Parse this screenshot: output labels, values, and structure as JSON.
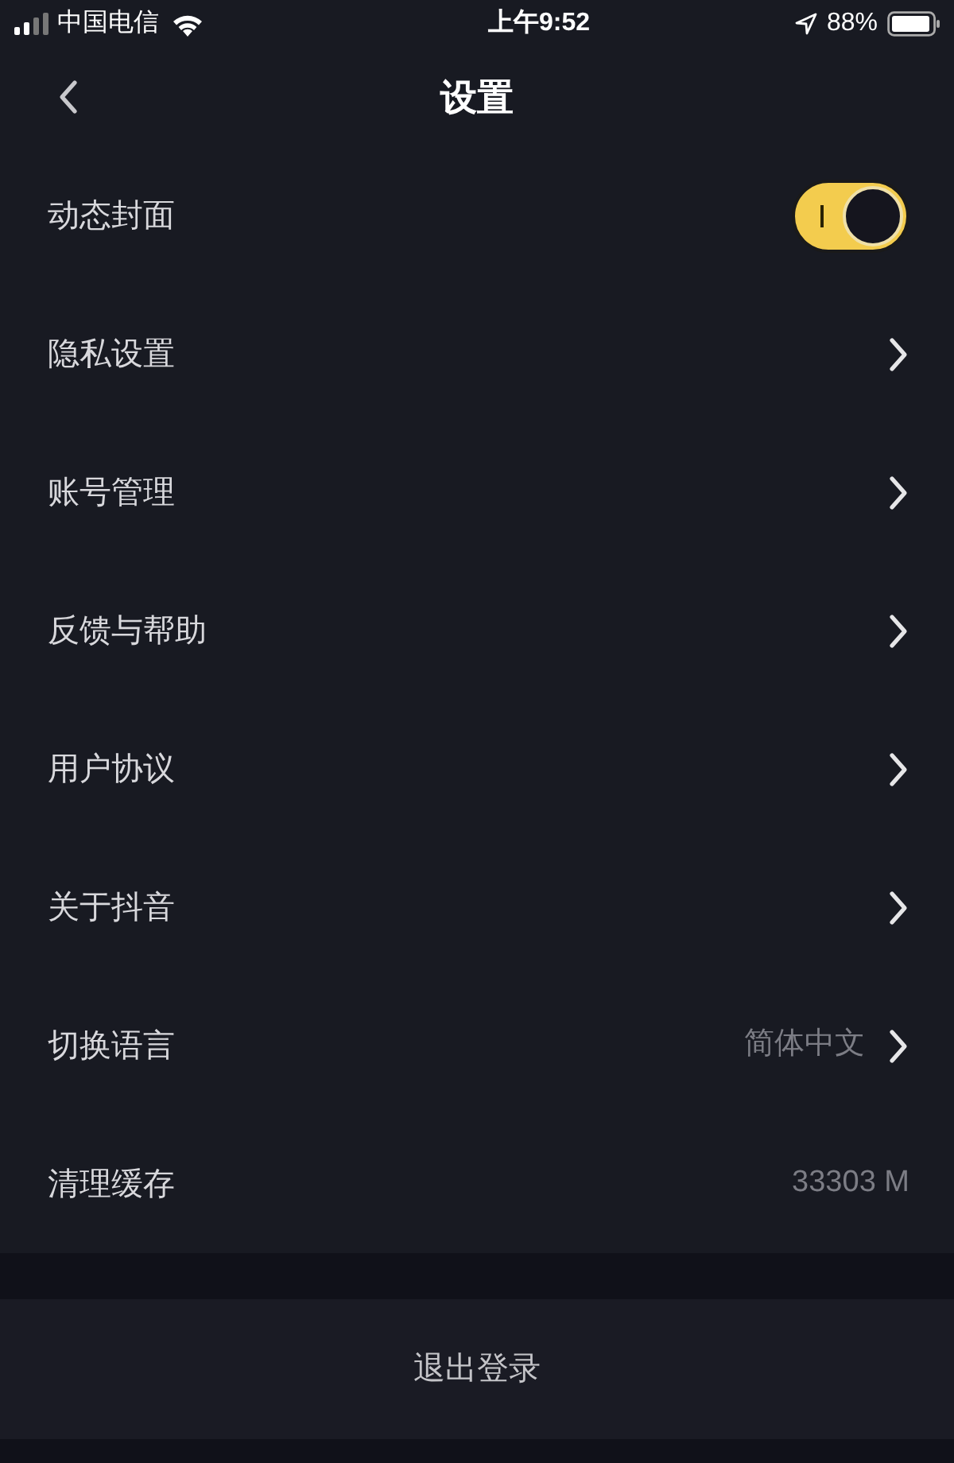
{
  "status_bar": {
    "carrier": "中国电信",
    "time": "上午9:52",
    "battery": "88%"
  },
  "nav": {
    "title": "设置"
  },
  "items": [
    {
      "kind": "toggle",
      "label": "动态封面",
      "on": true
    },
    {
      "kind": "link",
      "label": "隐私设置"
    },
    {
      "kind": "link",
      "label": "账号管理"
    },
    {
      "kind": "link",
      "label": "反馈与帮助"
    },
    {
      "kind": "link",
      "label": "用户协议"
    },
    {
      "kind": "link",
      "label": "关于抖音"
    },
    {
      "kind": "link",
      "label": "切换语言",
      "value": "简体中文"
    },
    {
      "kind": "value",
      "label": "清理缓存",
      "value": "33303 M"
    }
  ],
  "logout": {
    "label": "退出登录"
  }
}
